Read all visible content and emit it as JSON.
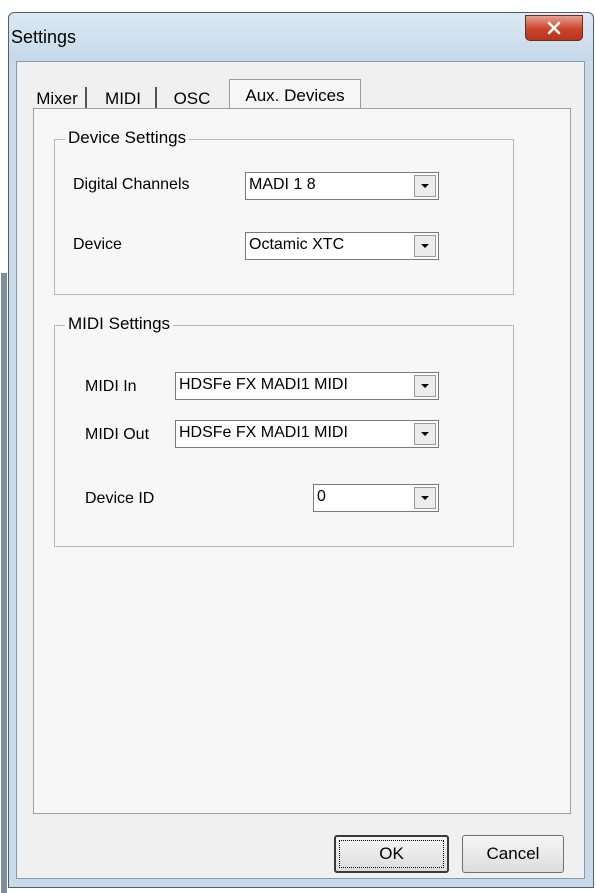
{
  "window": {
    "title": "Settings"
  },
  "tabs": [
    {
      "label": "Mixer"
    },
    {
      "label": "MIDI"
    },
    {
      "label": "OSC"
    },
    {
      "label": "Aux. Devices",
      "active": true
    }
  ],
  "device_settings": {
    "title": "Device Settings",
    "digital_channels": {
      "label": "Digital Channels",
      "value": "MADI 1 8"
    },
    "device": {
      "label": "Device",
      "value": "Octamic XTC"
    }
  },
  "midi_settings": {
    "title": "MIDI Settings",
    "midi_in": {
      "label": "MIDI In",
      "value": "HDSFe FX MADI1 MIDI"
    },
    "midi_out": {
      "label": "MIDI Out",
      "value": "HDSFe FX MADI1 MIDI"
    },
    "device_id": {
      "label": "Device ID",
      "value": "0"
    }
  },
  "buttons": {
    "ok": "OK",
    "cancel": "Cancel"
  },
  "colors": {
    "close_button": "#c9442a",
    "frame": "#c9dbe9",
    "dialog": "#f0f0f0"
  },
  "icons": {
    "close": "close-icon",
    "dropdown": "chevron-down-icon"
  }
}
